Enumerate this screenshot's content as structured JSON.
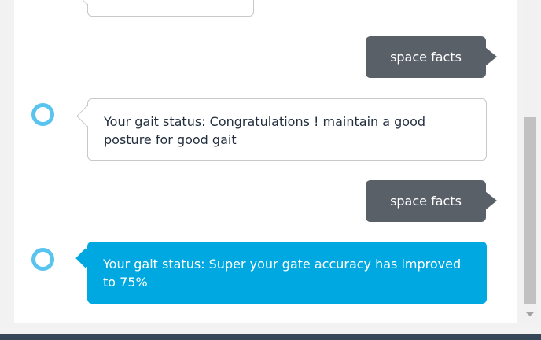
{
  "colors": {
    "alexa_ring": "#5ac4f0",
    "alexa_active_bubble": "#00a8e1",
    "user_bubble": "#5a6068",
    "alexa_bubble_border": "#c6c8cb"
  },
  "conversation": {
    "messages": [
      {
        "sender": "alexa",
        "text": ""
      },
      {
        "sender": "user",
        "text": "space facts"
      },
      {
        "sender": "alexa",
        "icon": "alexa-ring-icon",
        "text": "Your gait status: Congratulations ! maintain a good posture for good gait"
      },
      {
        "sender": "user",
        "text": "space facts"
      },
      {
        "sender": "alexa",
        "icon": "alexa-ring-icon",
        "active": true,
        "text": "Your gait status: Super your gate accuracy has improved to 75%"
      }
    ]
  }
}
